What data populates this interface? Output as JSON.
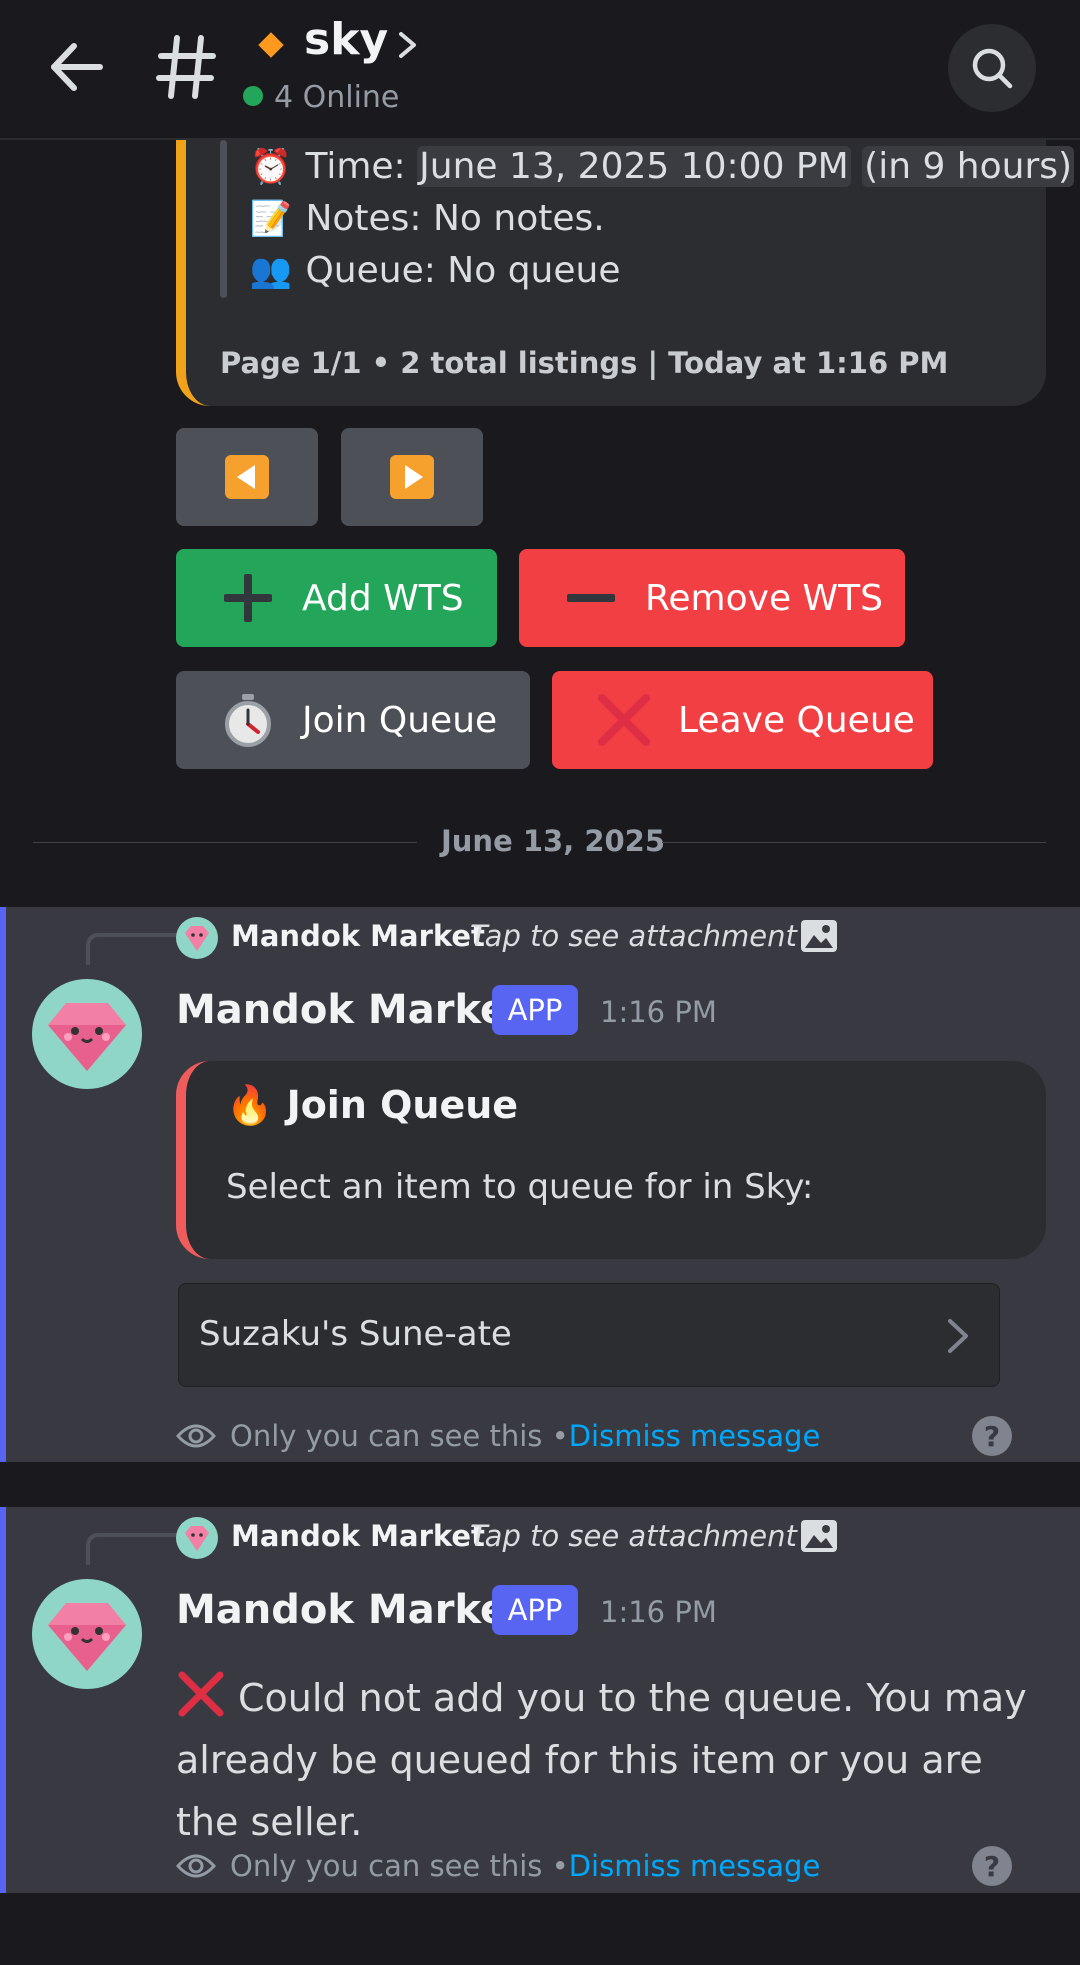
{
  "header": {
    "channel_name": "sky",
    "online_text": "4 Online"
  },
  "top_embed": {
    "time_label": "Time:",
    "time_value": "June 13, 2025 10:00 PM",
    "time_relative": "(in 9 hours)",
    "notes": "Notes: No notes.",
    "queue": "Queue: No queue",
    "footer": "Page 1/1 • 2 total listings | Today at 1:16 PM"
  },
  "buttons": {
    "add_wts": "Add WTS",
    "remove_wts": "Remove WTS",
    "join_queue": "Join Queue",
    "leave_queue": "Leave Queue"
  },
  "date_divider": "June 13, 2025",
  "messages": [
    {
      "reply_author": "Mandok Market",
      "reply_text": "Tap to see attachment",
      "author": "Mandok Market",
      "badge": "APP",
      "time": "1:16 PM",
      "embed_title": "Join Queue",
      "embed_desc": "Select an item to queue for in Sky:",
      "select_value": "Suzaku's Sune-ate",
      "ephemeral_note": "Only you can see this • ",
      "dismiss": "Dismiss message"
    },
    {
      "reply_author": "Mandok Market",
      "reply_text": "Tap to see attachment",
      "author": "Mandok Market",
      "badge": "APP",
      "time": "1:16 PM",
      "content": "Could not add you to the queue. You may already be queued for this item or you are the seller.",
      "ephemeral_note": "Only you can see this • ",
      "dismiss": "Dismiss message"
    }
  ],
  "colors": {
    "accent": "#5865f2",
    "green": "#23a55a",
    "red": "#f23f43",
    "link": "#00a8fc",
    "embed_orange": "#f0a31a"
  },
  "icons": [
    "back-arrow-icon",
    "hash-icon",
    "chevron-right-icon",
    "search-icon",
    "alarm-clock-icon",
    "memo-icon",
    "people-icon",
    "plus-icon",
    "minus-icon",
    "stopwatch-icon",
    "red-x-icon",
    "fire-icon",
    "image-icon",
    "eye-icon",
    "help-icon",
    "diamond-avatar-icon"
  ]
}
